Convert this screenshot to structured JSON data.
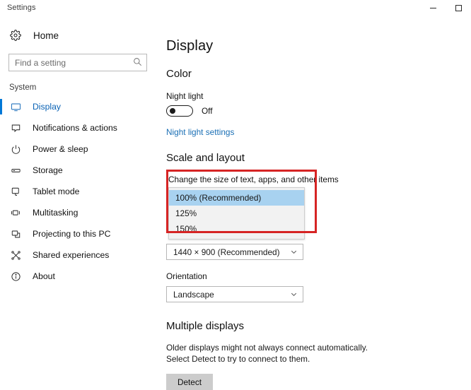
{
  "window": {
    "title": "Settings",
    "controls": [
      {
        "name": "minimize",
        "glyph": "minimize-icon"
      },
      {
        "name": "maximize",
        "glyph": "maximize-icon"
      }
    ]
  },
  "sidebar": {
    "home_label": "Home",
    "home_icon": "gear-icon",
    "search": {
      "placeholder": "Find a setting",
      "value": "",
      "icon": "search-icon"
    },
    "group_title": "System",
    "items": [
      {
        "label": "Display",
        "icon": "monitor-icon",
        "selected": true
      },
      {
        "label": "Notifications & actions",
        "icon": "notification-icon",
        "selected": false
      },
      {
        "label": "Power & sleep",
        "icon": "power-icon",
        "selected": false
      },
      {
        "label": "Storage",
        "icon": "storage-icon",
        "selected": false
      },
      {
        "label": "Tablet mode",
        "icon": "tablet-icon",
        "selected": false
      },
      {
        "label": "Multitasking",
        "icon": "multitasking-icon",
        "selected": false
      },
      {
        "label": "Projecting to this PC",
        "icon": "projecting-icon",
        "selected": false
      },
      {
        "label": "Shared experiences",
        "icon": "shared-icon",
        "selected": false
      },
      {
        "label": "About",
        "icon": "info-icon",
        "selected": false
      }
    ]
  },
  "main": {
    "page_title": "Display",
    "color": {
      "section_title": "Color",
      "night_light_label": "Night light",
      "night_light_state": "Off",
      "night_light_on": false,
      "night_light_link": "Night light settings"
    },
    "scale": {
      "section_title": "Scale and layout",
      "scale_label": "Change the size of text, apps, and other items",
      "scale_options": [
        "100% (Recommended)",
        "125%",
        "150%"
      ],
      "scale_selected_index": 0,
      "dropdown_open": true,
      "resolution_value": "1440 × 900 (Recommended)",
      "orientation_label": "Orientation",
      "orientation_value": "Landscape",
      "chevron_icon": "chevron-down-icon"
    },
    "multiple_displays": {
      "section_title": "Multiple displays",
      "description": "Older displays might not always connect automatically. Select Detect to try to connect to them.",
      "detect_label": "Detect"
    },
    "accent_color": "#0078d7",
    "highlight_color": "#a8d2f0",
    "annotation_color": "#d62424",
    "link_color": "#1a6fb5"
  }
}
